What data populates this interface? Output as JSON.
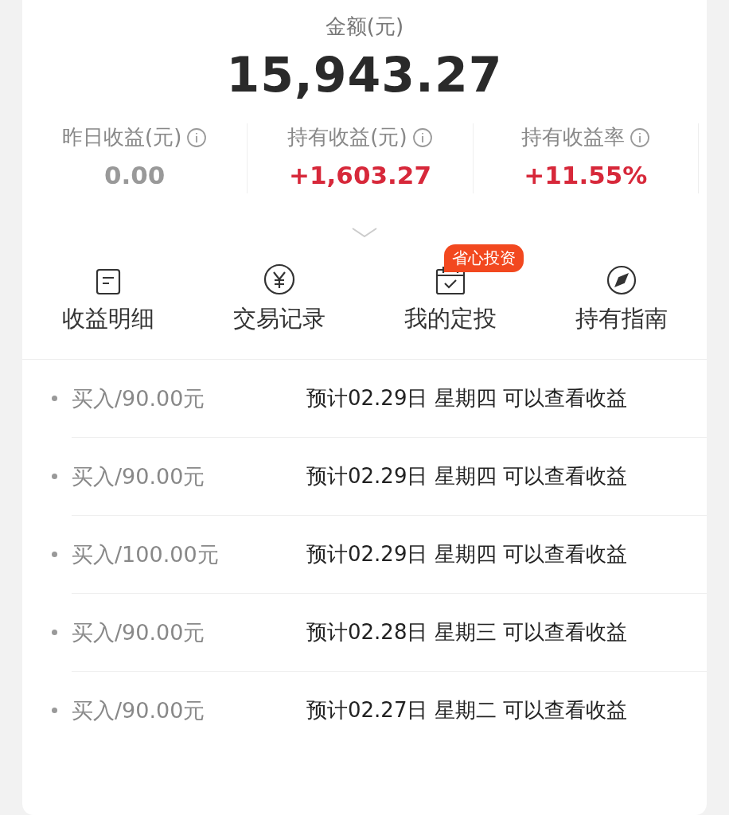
{
  "summary": {
    "label": "金额(元)",
    "amount": "15,943.27"
  },
  "stats": [
    {
      "label": "昨日收益(元)",
      "value": "0.00",
      "color": "#999999"
    },
    {
      "label": "持有收益(元)",
      "value": "+1,603.27",
      "color": "#d7283a"
    },
    {
      "label": "持有收益率",
      "value": "+11.55%",
      "color": "#d7283a"
    }
  ],
  "shortcuts": [
    {
      "label": "收益明细"
    },
    {
      "label": "交易记录"
    },
    {
      "label": "我的定投",
      "badge": "省心投资"
    },
    {
      "label": "持有指南"
    }
  ],
  "records": [
    {
      "action": "买入/90.00元",
      "note": "预计02.29日 星期四 可以查看收益"
    },
    {
      "action": "买入/90.00元",
      "note": "预计02.29日 星期四 可以查看收益"
    },
    {
      "action": "买入/100.00元",
      "note": "预计02.29日 星期四 可以查看收益"
    },
    {
      "action": "买入/90.00元",
      "note": "预计02.28日 星期三 可以查看收益"
    },
    {
      "action": "买入/90.00元",
      "note": "预计02.27日 星期二 可以查看收益"
    }
  ]
}
